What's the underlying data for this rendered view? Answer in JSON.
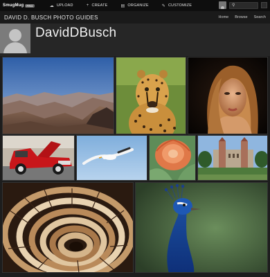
{
  "topbar": {
    "logo": "SmugMug",
    "logo_badge": "PRO",
    "nav": [
      {
        "label": "UPLOAD",
        "icon": "cloud-upload-icon"
      },
      {
        "label": "CREATE",
        "icon": "plus-icon"
      },
      {
        "label": "ORGANIZE",
        "icon": "folder-icon"
      },
      {
        "label": "CUSTOMIZE",
        "icon": "paintbrush-icon"
      }
    ]
  },
  "header": {
    "site_title": "DAVID D. BUSCH PHOTO GUIDES",
    "nav": [
      "Home",
      "Browse",
      "Search"
    ]
  },
  "profile": {
    "name": "DavidDBusch"
  },
  "photos": [
    "grand-canyon",
    "cheetah",
    "woman-portrait",
    "red-classic-car",
    "seagull",
    "succulent",
    "palace",
    "spiral-staircase",
    "peacock"
  ]
}
